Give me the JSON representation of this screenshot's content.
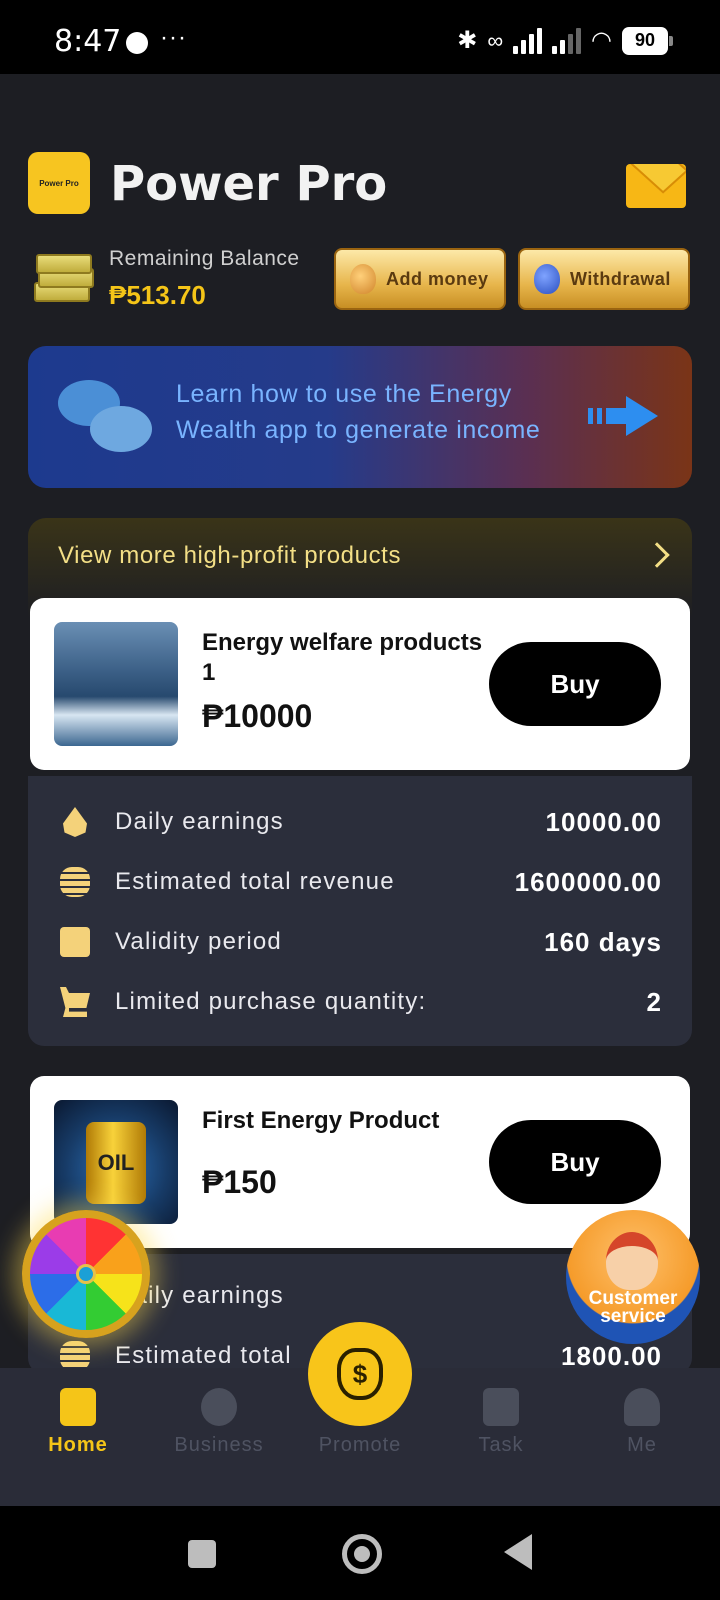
{
  "status_bar": {
    "time": "8:47",
    "overflow": "···",
    "battery": "90"
  },
  "header": {
    "logo_text": "Power Pro",
    "title": "Power Pro"
  },
  "balance": {
    "label": "Remaining Balance",
    "value": "₱513.70",
    "add_money_label": "Add money",
    "withdrawal_label": "Withdrawal"
  },
  "banner": {
    "text": "Learn how to use the Energy Wealth app to generate income"
  },
  "more_products": {
    "label": "View more high-profit products"
  },
  "products": [
    {
      "name": "Energy welfare products 1",
      "price": "₱10000",
      "buy_label": "Buy",
      "details": [
        {
          "label": "Daily earnings",
          "value": "10000.00",
          "icon": "drop-icon"
        },
        {
          "label": "Estimated total revenue",
          "value": "1600000.00",
          "icon": "coins-icon"
        },
        {
          "label": "Validity period",
          "value": "160 days",
          "icon": "calendar-icon"
        },
        {
          "label": "Limited purchase quantity:",
          "value": "2",
          "icon": "cart-icon"
        }
      ]
    },
    {
      "name": "First Energy Product",
      "price": "₱150",
      "buy_label": "Buy",
      "image_text": "OIL",
      "details": [
        {
          "label": "Daily earnings",
          "icon": "drop-icon"
        },
        {
          "label": "Estimated total",
          "value": "1800.00",
          "icon": "coins-icon"
        }
      ]
    }
  ],
  "customer_service": {
    "label_line1": "Customer",
    "label_line2": "service"
  },
  "tabs": [
    {
      "label": "Home",
      "icon": "fuel-pump-icon",
      "active": true
    },
    {
      "label": "Business",
      "icon": "exchange-icon",
      "active": false
    },
    {
      "label": "Promote",
      "icon": "money-bag-icon",
      "active": false
    },
    {
      "label": "Task",
      "icon": "document-icon",
      "active": false
    },
    {
      "label": "Me",
      "icon": "user-icon",
      "active": false
    }
  ],
  "colors": {
    "accent": "#f5c518",
    "background": "#1d1e23",
    "card": "#ffffff",
    "details_bg": "#2b2e3b",
    "banner_text": "#79b4ff"
  }
}
